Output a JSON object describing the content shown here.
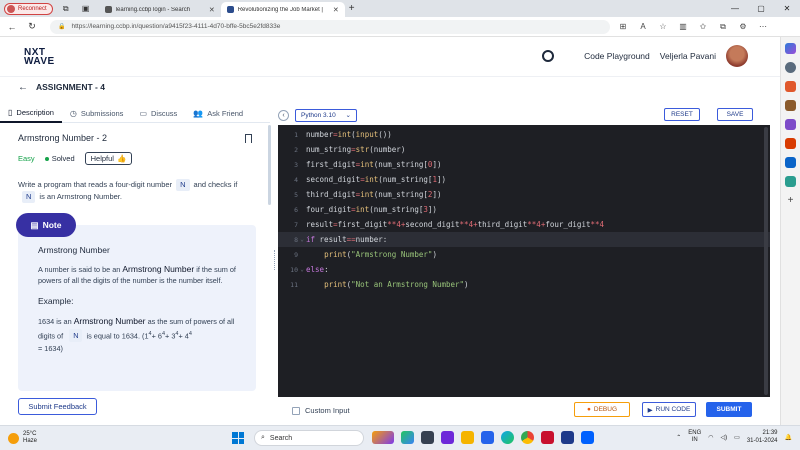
{
  "browser": {
    "reconnect_label": "Reconnect",
    "tabs": [
      {
        "title": "learning.ccbp login - Search"
      },
      {
        "title": "Revolutionizing the Job Market |"
      }
    ],
    "url": "https://learning.ccbp.in/question/a9415f23-4111-4d70-bffe-5bc5e2fd833e"
  },
  "header": {
    "logo_line1": "NXT",
    "logo_line2": "WAVE",
    "code_playground": "Code Playground",
    "user_name": "Veljerla Pavani"
  },
  "assignment": {
    "title": "ASSIGNMENT - 4"
  },
  "left_tabs": [
    {
      "label": "Description"
    },
    {
      "label": "Submissions"
    },
    {
      "label": "Discuss"
    },
    {
      "label": "Ask Friend"
    }
  ],
  "problem": {
    "title": "Armstrong Number - 2",
    "difficulty": "Easy",
    "status": "Solved",
    "helpful_label": "Helpful",
    "desc_part1": "Write a program that reads a four-digit number",
    "desc_code": "N",
    "desc_part2": "and checks if",
    "desc_code2": "N",
    "desc_part3": "is an Armstrong Number."
  },
  "note": {
    "label": "Note",
    "heading": "Armstrong Number",
    "body_part1": "A number is said to be an",
    "body_em": "Armstrong Number",
    "body_part2": "if the sum of powers of all the digits of the number is the number itself.",
    "example_heading": "Example:",
    "ex_part1": "1634 is an",
    "ex_em": "Armstrong Number",
    "ex_part2": "as the sum of powers of all digits of",
    "ex_code": "N",
    "ex_part3": "is equal to 1634. (1",
    "ex_sup1": "4",
    "ex_part4": "+ 6",
    "ex_sup2": "4",
    "ex_part5": "+ 3",
    "ex_sup3": "4",
    "ex_part6": "+ 4",
    "ex_sup4": "4",
    "ex_part7": "= 1634)"
  },
  "submit_feedback": "Submit Feedback",
  "editor": {
    "language": "Python 3.10",
    "reset": "RESET",
    "save": "SAVE",
    "lines": [
      {
        "n": "1"
      },
      {
        "n": "2"
      },
      {
        "n": "3"
      },
      {
        "n": "4"
      },
      {
        "n": "5"
      },
      {
        "n": "6"
      },
      {
        "n": "7"
      },
      {
        "n": "8"
      },
      {
        "n": "9"
      },
      {
        "n": "10"
      },
      {
        "n": "11"
      }
    ],
    "custom_input": "Custom Input",
    "debug": "DEBUG",
    "run_code": "RUN CODE",
    "submit": "SUBMIT"
  },
  "taskbar": {
    "temp": "25°C",
    "weather": "Haze",
    "search": "Search",
    "lang1": "ENG",
    "lang2": "IN",
    "time": "21:39",
    "date": "31-01-2024"
  }
}
